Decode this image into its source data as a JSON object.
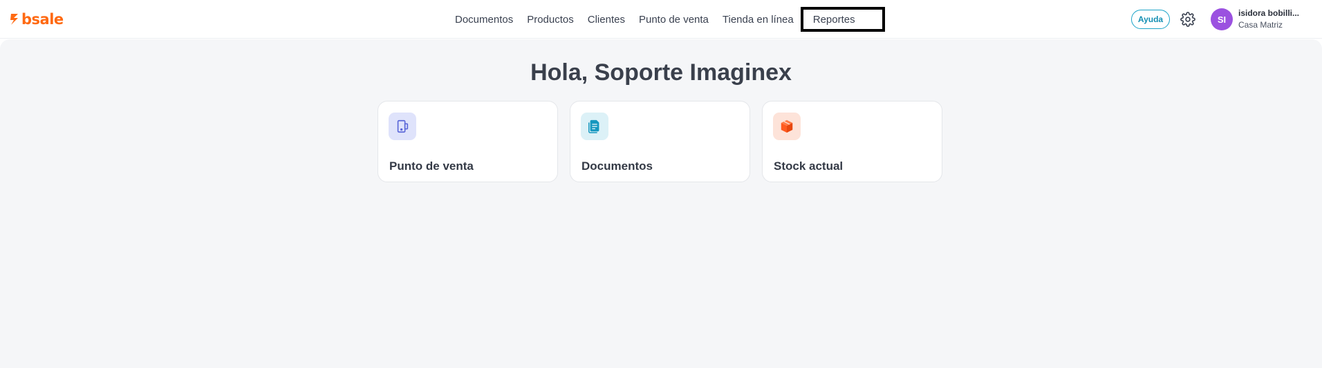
{
  "brand": {
    "name": "bsale",
    "color": "#ff6a13"
  },
  "nav": {
    "items": [
      {
        "label": "Documentos"
      },
      {
        "label": "Productos"
      },
      {
        "label": "Clientes"
      },
      {
        "label": "Punto de venta"
      },
      {
        "label": "Tienda en línea"
      },
      {
        "label": "Reportes"
      }
    ]
  },
  "header": {
    "help_label": "Ayuda",
    "settings_icon": "gear-icon",
    "user": {
      "initials": "SI",
      "name": "isidora bobilli...",
      "branch": "Casa Matriz",
      "avatar_color": "#9b51e0"
    }
  },
  "main": {
    "greeting": "Hola, Soporte Imaginex",
    "cards": [
      {
        "title": "Punto de venta",
        "icon": "pos-terminal-icon",
        "icon_bg": "#dfe3fb",
        "icon_color": "#5b67d8"
      },
      {
        "title": "Documentos",
        "icon": "document-icon",
        "icon_bg": "#dcf1f7",
        "icon_color": "#1597bf"
      },
      {
        "title": "Stock actual",
        "icon": "box-icon",
        "icon_bg": "#fde3d9",
        "icon_color": "#ff5a1f"
      }
    ]
  }
}
